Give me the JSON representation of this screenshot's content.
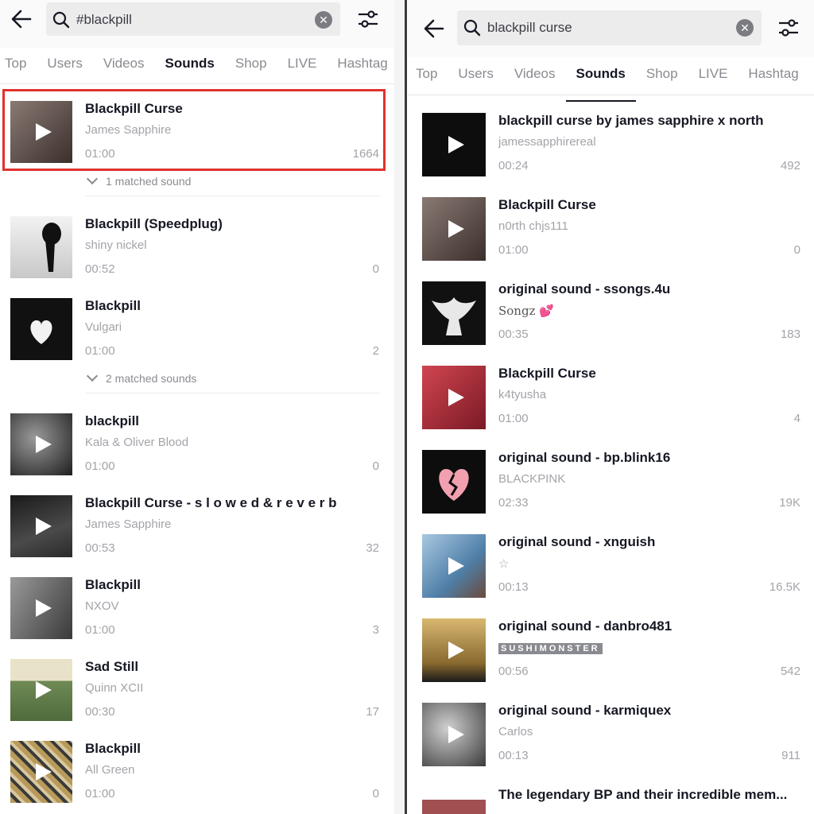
{
  "tabs": [
    "Top",
    "Users",
    "Videos",
    "Sounds",
    "Shop",
    "LIVE",
    "Hashtag"
  ],
  "left": {
    "query": "#blackpill",
    "active_tab": "Sounds",
    "results": [
      {
        "title": "Blackpill Curse",
        "artist": "James Sapphire",
        "duration": "01:00",
        "count": "1664",
        "matched": "1 matched sound",
        "thumb": "#5a4d4a"
      },
      {
        "title": "Blackpill (Speedplug)",
        "artist": "shiny nickel",
        "duration": "00:52",
        "count": "0",
        "thumb": "#d9d9d9"
      },
      {
        "title": "Blackpill",
        "artist": "Vulgari",
        "duration": "01:00",
        "count": "2",
        "matched": "2 matched sounds",
        "thumb": "#111111"
      },
      {
        "title": "blackpill",
        "artist": "Kala & Oliver Blood",
        "duration": "01:00",
        "count": "0",
        "thumb": "#3d3d3d"
      },
      {
        "title": "Blackpill Curse - s l o w e d & r e v e r b",
        "artist": "James Sapphire",
        "duration": "00:53",
        "count": "32",
        "thumb": "#2b2b2b"
      },
      {
        "title": "Blackpill",
        "artist": "NXOV",
        "duration": "01:00",
        "count": "3",
        "thumb": "#6b6b6b"
      },
      {
        "title": "Sad Still",
        "artist": "Quinn XCII",
        "duration": "00:30",
        "count": "17",
        "thumb": "#8aa06e"
      },
      {
        "title": "Blackpill",
        "artist": "All Green",
        "duration": "01:00",
        "count": "0",
        "thumb": "#8b7a55"
      }
    ]
  },
  "right": {
    "query": "blackpill curse",
    "active_tab": "Sounds",
    "results": [
      {
        "title": "blackpill curse by james sapphire x north",
        "artist": "jamessapphirereal",
        "duration": "00:24",
        "count": "492",
        "thumb": "#0d0d0d"
      },
      {
        "title": "Blackpill Curse",
        "artist": "n0rth chjs111",
        "duration": "01:00",
        "count": "0",
        "thumb": "#5a4d4a"
      },
      {
        "title": "original sound - ssongs.4u",
        "artist": "Songz 💕",
        "duration": "00:35",
        "count": "183",
        "thumb": "#1a1a1a"
      },
      {
        "title": "Blackpill Curse",
        "artist": "k4tyusha",
        "duration": "01:00",
        "count": "4",
        "thumb": "#b0313b"
      },
      {
        "title": "original sound - bp.blink16",
        "artist": "BLACKPINK",
        "duration": "02:33",
        "count": "19K",
        "thumb": "#0d0d0d"
      },
      {
        "title": "original sound - xnguish",
        "artist": "☆",
        "duration": "00:13",
        "count": "16.5K",
        "thumb": "#6f9bc2"
      },
      {
        "title": "original sound - danbro481",
        "artist": "SUSHIMONSTER",
        "duration": "00:56",
        "count": "542",
        "thumb": "#c9a35a"
      },
      {
        "title": "original sound - karmiquex",
        "artist": "Carlos",
        "duration": "00:13",
        "count": "911",
        "thumb": "#9a9a9a"
      },
      {
        "title": "The legendary BP and their incredible mem...",
        "thumb": "#a05050"
      }
    ]
  }
}
